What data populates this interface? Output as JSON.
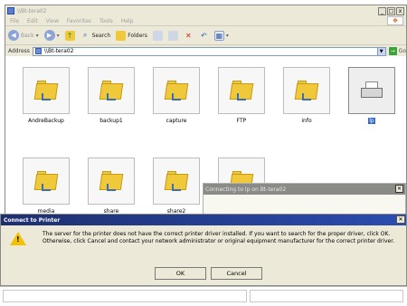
{
  "window": {
    "title": "\\\\Bt-tera02"
  },
  "titlebar_buttons": {
    "minimize": "_",
    "maximize": "□",
    "close": "x"
  },
  "menu": [
    "File",
    "Edit",
    "View",
    "Favorites",
    "Tools",
    "Help"
  ],
  "toolbar": {
    "back": "Back",
    "search": "Search",
    "folders": "Folders"
  },
  "address": {
    "label": "Address",
    "value": "\\\\Bt-tera02",
    "go": "Go"
  },
  "items": [
    {
      "label": "AndreBackup",
      "type": "share"
    },
    {
      "label": "backup1",
      "type": "share"
    },
    {
      "label": "capture",
      "type": "share"
    },
    {
      "label": "FTP",
      "type": "share"
    },
    {
      "label": "info",
      "type": "share"
    },
    {
      "label": "lp",
      "type": "printer"
    },
    {
      "label": "media",
      "type": "share"
    },
    {
      "label": "share",
      "type": "share"
    },
    {
      "label": "share2",
      "type": "share"
    },
    {
      "label": "",
      "type": "share"
    }
  ],
  "ghost_dialog": {
    "title": "Connecting to lp on Bt-tera02"
  },
  "dialog": {
    "title": "Connect to Printer",
    "message": "The server for the printer does not have the correct printer driver installed.  If you want to search for the proper driver, click OK.  Otherwise, click Cancel and contact your network administrator or original equipment manufacturer for the correct printer driver.",
    "ok": "OK",
    "cancel": "Cancel"
  },
  "colors": {
    "title_bar": "#1d2f6e",
    "warning": "#f2c200",
    "selection": "#3169c6"
  }
}
